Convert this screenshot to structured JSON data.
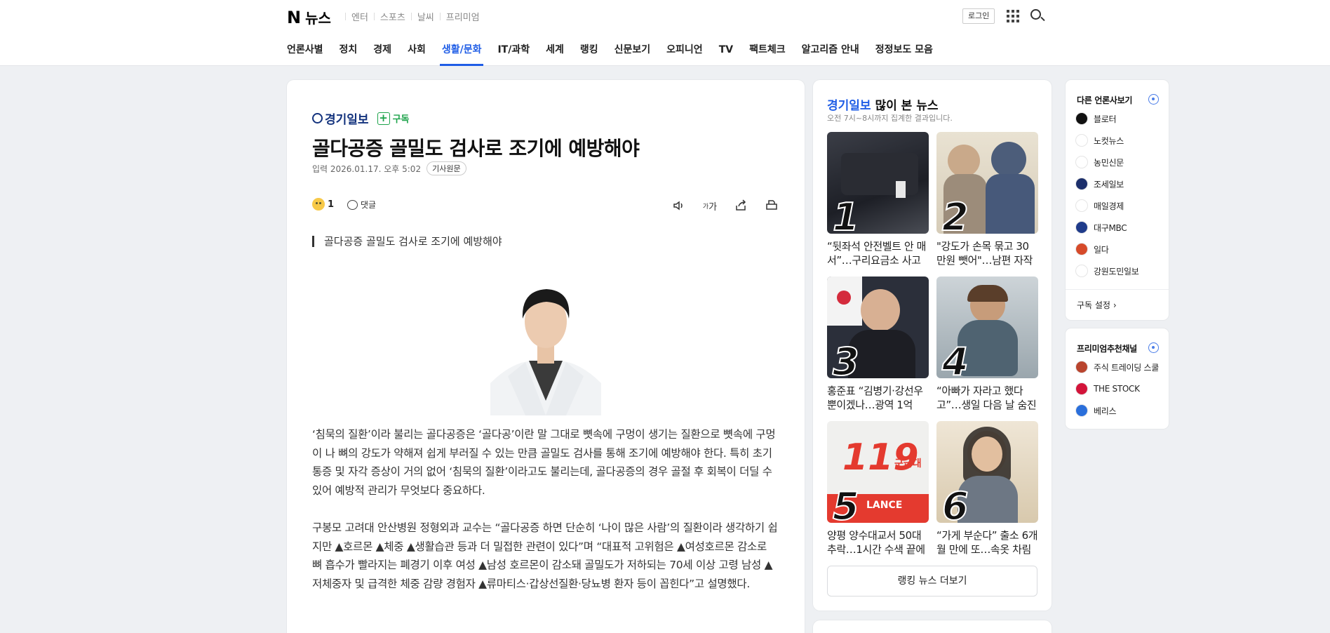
{
  "header": {
    "logo_n": "N",
    "logo_text": "뉴스",
    "services": [
      "엔터",
      "스포츠",
      "날씨",
      "프리미엄"
    ],
    "login_label": "로그인"
  },
  "nav": [
    "언론사별",
    "정치",
    "경제",
    "사회",
    "생활/문화",
    "IT/과학",
    "세계",
    "랭킹",
    "신문보기",
    "오피니언",
    "TV",
    "팩트체크",
    "알고리즘 안내",
    "정정보도 모음"
  ],
  "nav_active_index": 4,
  "article": {
    "press_name": "경기일보",
    "subscribe_label": "구독",
    "headline": "골다공증 골밀도 검사로 조기에 예방해야",
    "date_label": "입력 2026.01.17. 오후 5:02",
    "origin_label": "기사원문",
    "reaction_count": "1",
    "comment_label": "댓글",
    "font_tool_label": "가",
    "subhead": "골다공증 골밀도 검사로 조기에 예방해야",
    "paragraphs": [
      "‘침묵의 질환’이라 불리는 골다공증은 ‘골다공’이란 말 그대로 뼛속에 구멍이 생기는 질환으로 뼛속에 구멍이 나 뼈의 강도가 약해져 쉽게 부러질 수 있는 만큼 골밀도 검사를 통해 조기에 예방해야 한다. 특히 초기 통증 및 자각 증상이 거의 없어 ‘침묵의 질환’이라고도 불리는데, 골다공증의 경우 골절 후 회복이 더딜 수 있어 예방적 관리가 무엇보다 중요하다.",
      "구봉모 고려대 안산병원 정형외과 교수는 “골다공증 하면 단순히 ‘나이 많은 사람’의 질환이라 생각하기 쉽지만 ▲호르몬 ▲체중 ▲생활습관 등과 더 밀접한 관련이 있다”며 “대표적 고위험은 ▲여성호르몬 감소로 뼈 흡수가 빨라지는 폐경기 이후 여성 ▲남성 호르몬이 감소돼 골밀도가 저하되는 70세 이상 고령 남성 ▲저체중자 및 급격한 체중 감량 경험자 ▲류마티스·갑상선질환·당뇨병 환자 등이 꼽힌다”고 설명했다."
    ]
  },
  "ranking": {
    "press_name": "경기일보",
    "title_suffix": " 많이 본 뉴스",
    "subtitle": "오전 7시~8시까지 집계한 결과입니다.",
    "items": [
      {
        "rank": "1",
        "text": "“뒷좌석 안전벨트 안 매서”…구리요금소 사고"
      },
      {
        "rank": "2",
        "text": "\"강도가 손목 묶고 30만원 뺏어\"…남편 자작극"
      },
      {
        "rank": "3",
        "text": "홍준표 “김병기·강선우뿐이겠나…광역 1억"
      },
      {
        "rank": "4",
        "text": "“아빠가 자라고 했다고”…생일 다음 날 숨진"
      },
      {
        "rank": "5",
        "text": "양평 양수대교서 50대 추락…1시간 수색 끝에"
      },
      {
        "rank": "6",
        "text": "“가게 부순다” 출소 6개월 만에 또…속옷 차림"
      }
    ],
    "thumb_texts": {
      "sign_119": "119",
      "sign_kor": "구급대",
      "sign_eng": "LANCE"
    },
    "more_label": "랭킹 뉴스 더보기"
  },
  "sidebar": {
    "other_press_title": "다른 언론사보기",
    "other_press": [
      {
        "name": "블로터",
        "color": "#111111"
      },
      {
        "name": "노컷뉴스",
        "color": "#ffffff"
      },
      {
        "name": "농민신문",
        "color": "#ffffff"
      },
      {
        "name": "조세일보",
        "color": "#1c2f6b"
      },
      {
        "name": "매일경제",
        "color": "#ffffff"
      },
      {
        "name": "대구MBC",
        "color": "#1f3b8a"
      },
      {
        "name": "일다",
        "color": "#d64a2a"
      },
      {
        "name": "강원도민일보",
        "color": "#ffffff"
      }
    ],
    "subscribe_setting": "구독 설정",
    "premium_title": "프리미엄추천채널",
    "premium": [
      {
        "name": "주식 트레이딩 스쿨",
        "color": "#b9442e"
      },
      {
        "name": "THE STOCK",
        "color": "#d3143a"
      },
      {
        "name": "베리스",
        "color": "#2a6fdb"
      }
    ]
  },
  "colors": {
    "accent": "#1f5de6",
    "subscribe": "#1ca34a",
    "press_logo": "#12327d"
  }
}
